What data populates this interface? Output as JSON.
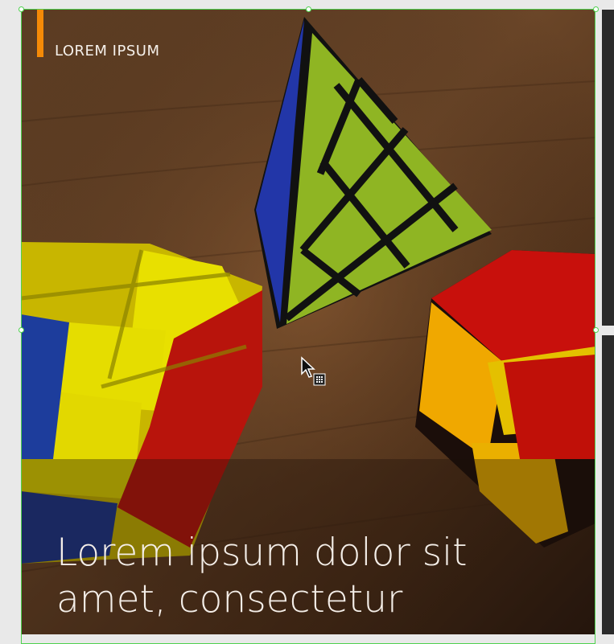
{
  "card": {
    "eyebrow": "LOREM IPSUM",
    "headline": "Lorem ipsum dolor sit amet, consectetur",
    "accent_color": "#f58a07",
    "selection_color": "#4fd24f"
  },
  "icons": {
    "cursor": "move-cursor-icon"
  }
}
